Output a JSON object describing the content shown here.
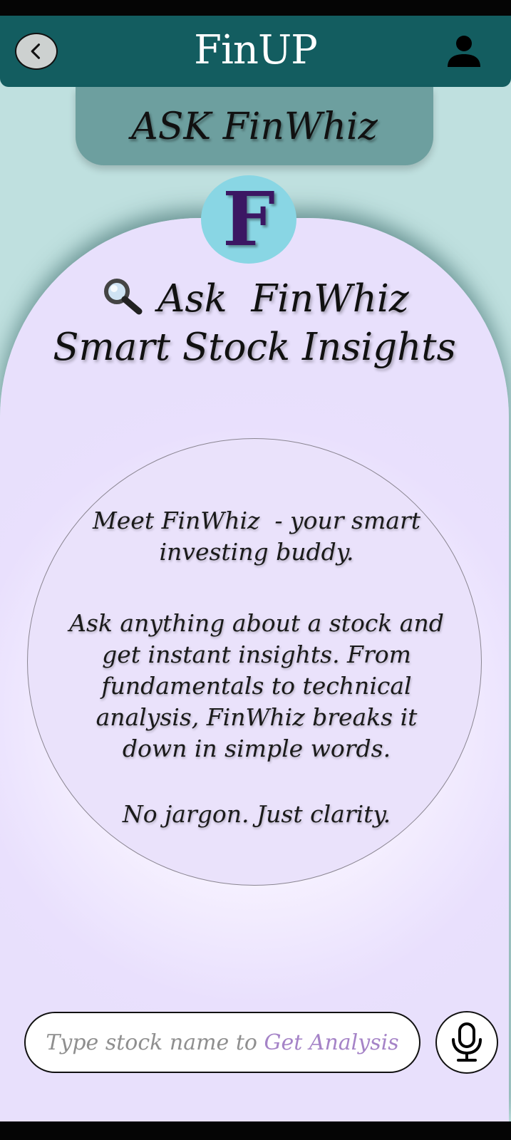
{
  "app_bar": {
    "title": "FinUP",
    "back_icon": "chevron-left-icon",
    "profile_icon": "person-icon"
  },
  "ask_tab": {
    "title": "ASK FinWhiz"
  },
  "logo": {
    "letter": "F"
  },
  "headline": {
    "icon": "magnifier-icon",
    "line1": "Ask  FinWhiz",
    "line2": "Smart Stock Insights"
  },
  "info": {
    "intro_line1": "Meet FinWhiz  - your smart",
    "intro_line2": "investing buddy.",
    "body_line1": "Ask anything about a stock and",
    "body_line2": "get instant insights. From",
    "body_line3": "fundamentals to technical",
    "body_line4": "analysis, FinWhiz breaks it",
    "body_line5": "down in simple words.",
    "tagline": "No jargon. Just clarity."
  },
  "search": {
    "placeholder_prefix": "Type stock name to ",
    "placeholder_highlight": "Get Analysis"
  },
  "mic": {
    "icon": "microphone-icon"
  },
  "colors": {
    "app_bar": "#135d60",
    "page_bg": "#bfe0df",
    "tab_bg": "#6d9f9f",
    "arch_bg": "#e8e0fc",
    "logo_bg": "#89d6e4",
    "logo_letter": "#3b1763",
    "placeholder_highlight": "#a583c7"
  }
}
